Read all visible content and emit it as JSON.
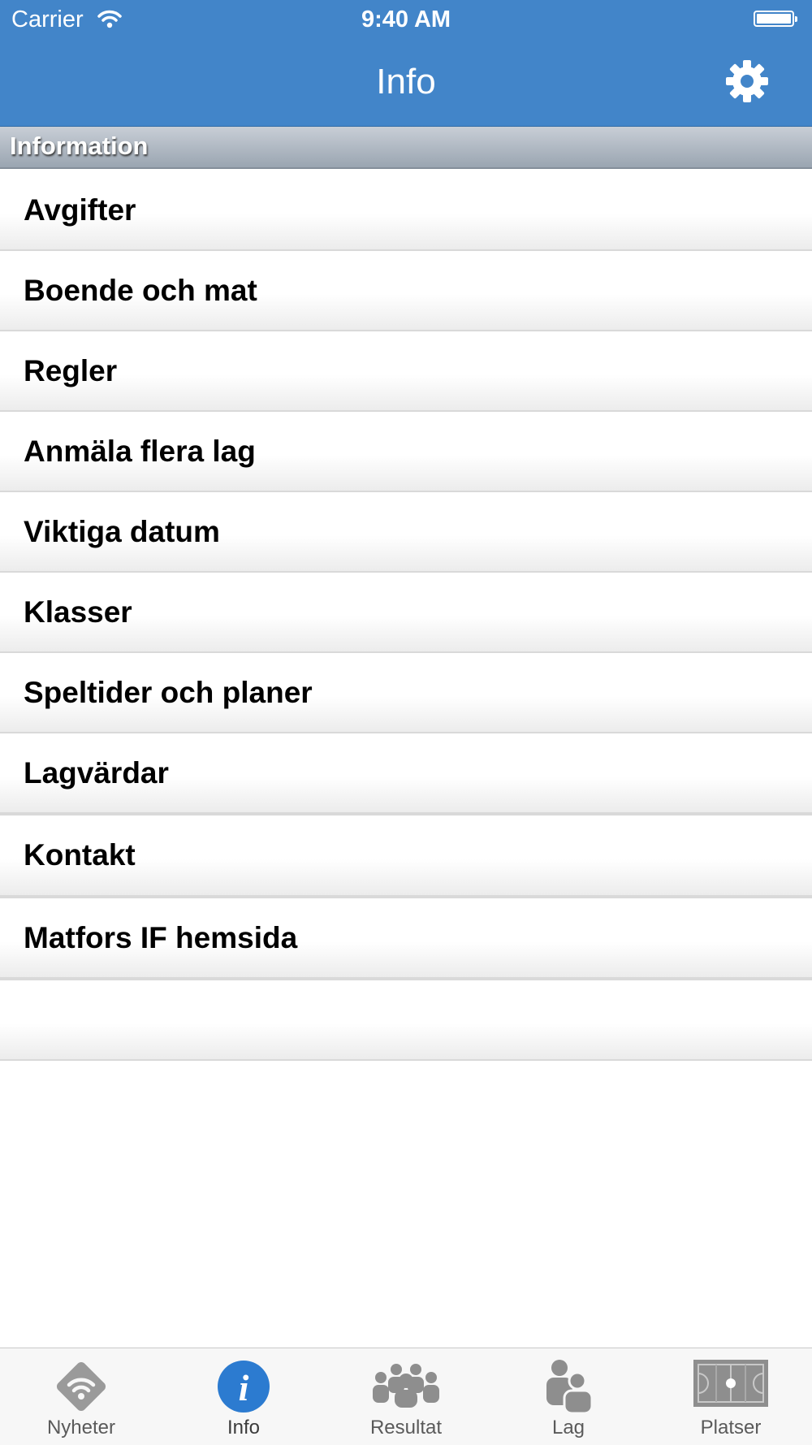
{
  "status_bar": {
    "carrier": "Carrier",
    "time": "9:40 AM"
  },
  "nav": {
    "title": "Info",
    "settings_icon": "gear-icon"
  },
  "section": {
    "title": "Information"
  },
  "items": [
    {
      "label": "Avgifter"
    },
    {
      "label": "Boende och mat"
    },
    {
      "label": "Regler"
    },
    {
      "label": "Anmäla flera lag"
    },
    {
      "label": "Viktiga datum"
    },
    {
      "label": "Klasser"
    },
    {
      "label": "Speltider och planer"
    },
    {
      "label": "Lagvärdar"
    },
    {
      "label": "Kontakt"
    },
    {
      "label": "Matfors IF hemsida"
    }
  ],
  "tabs": [
    {
      "label": "Nyheter",
      "icon": "news-feed-icon",
      "active": false
    },
    {
      "label": "Info",
      "icon": "info-icon",
      "active": true
    },
    {
      "label": "Resultat",
      "icon": "people-group-icon",
      "active": false
    },
    {
      "label": "Lag",
      "icon": "team-icon",
      "active": false
    },
    {
      "label": "Platser",
      "icon": "field-icon",
      "active": false
    }
  ],
  "colors": {
    "nav_bar": "#4285c9",
    "active_tab": "#2c7bd0",
    "inactive_tab": "#8e8e8e"
  }
}
